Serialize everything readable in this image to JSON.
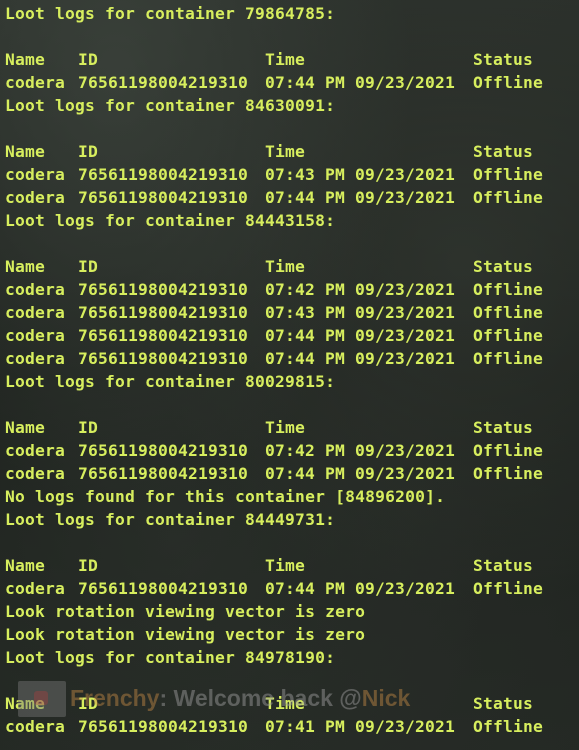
{
  "columns": [
    "Name",
    "ID",
    "Time",
    "Status"
  ],
  "blocks": [
    {
      "header": "Loot logs for container 79864785:",
      "rows": [
        {
          "name": "codera",
          "id": "76561198004219310",
          "time": "07:44 PM 09/23/2021",
          "status": "Offline"
        }
      ]
    },
    {
      "header": "Loot logs for container 84630091:",
      "rows": [
        {
          "name": "codera",
          "id": "76561198004219310",
          "time": "07:43 PM 09/23/2021",
          "status": "Offline"
        },
        {
          "name": "codera",
          "id": "76561198004219310",
          "time": "07:44 PM 09/23/2021",
          "status": "Offline"
        }
      ]
    },
    {
      "header": "Loot logs for container 84443158:",
      "rows": [
        {
          "name": "codera",
          "id": "76561198004219310",
          "time": "07:42 PM 09/23/2021",
          "status": "Offline"
        },
        {
          "name": "codera",
          "id": "76561198004219310",
          "time": "07:43 PM 09/23/2021",
          "status": "Offline"
        },
        {
          "name": "codera",
          "id": "76561198004219310",
          "time": "07:44 PM 09/23/2021",
          "status": "Offline"
        },
        {
          "name": "codera",
          "id": "76561198004219310",
          "time": "07:44 PM 09/23/2021",
          "status": "Offline"
        }
      ]
    },
    {
      "header": "Loot logs for container 80029815:",
      "rows": [
        {
          "name": "codera",
          "id": "76561198004219310",
          "time": "07:42 PM 09/23/2021",
          "status": "Offline"
        },
        {
          "name": "codera",
          "id": "76561198004219310",
          "time": "07:44 PM 09/23/2021",
          "status": "Offline"
        }
      ]
    },
    {
      "header": "Loot logs for container 84449731:",
      "pre": [
        "No logs found for this container [84896200]."
      ],
      "rows": [
        {
          "name": "codera",
          "id": "76561198004219310",
          "time": "07:44 PM 09/23/2021",
          "status": "Offline"
        }
      ]
    },
    {
      "header": "Loot logs for container 84978190:",
      "pre": [
        "Look rotation viewing vector is zero",
        "Look rotation viewing vector is zero"
      ],
      "rows": [
        {
          "name": "codera",
          "id": "76561198004219310",
          "time": "07:41 PM 09/23/2021",
          "status": "Offline"
        }
      ]
    }
  ],
  "overlay": {
    "name": "Frenchy",
    "message": ": Welcome back @",
    "user": "Nick"
  },
  "colors": {
    "text": "#d7ee5e",
    "background": "#202421"
  }
}
